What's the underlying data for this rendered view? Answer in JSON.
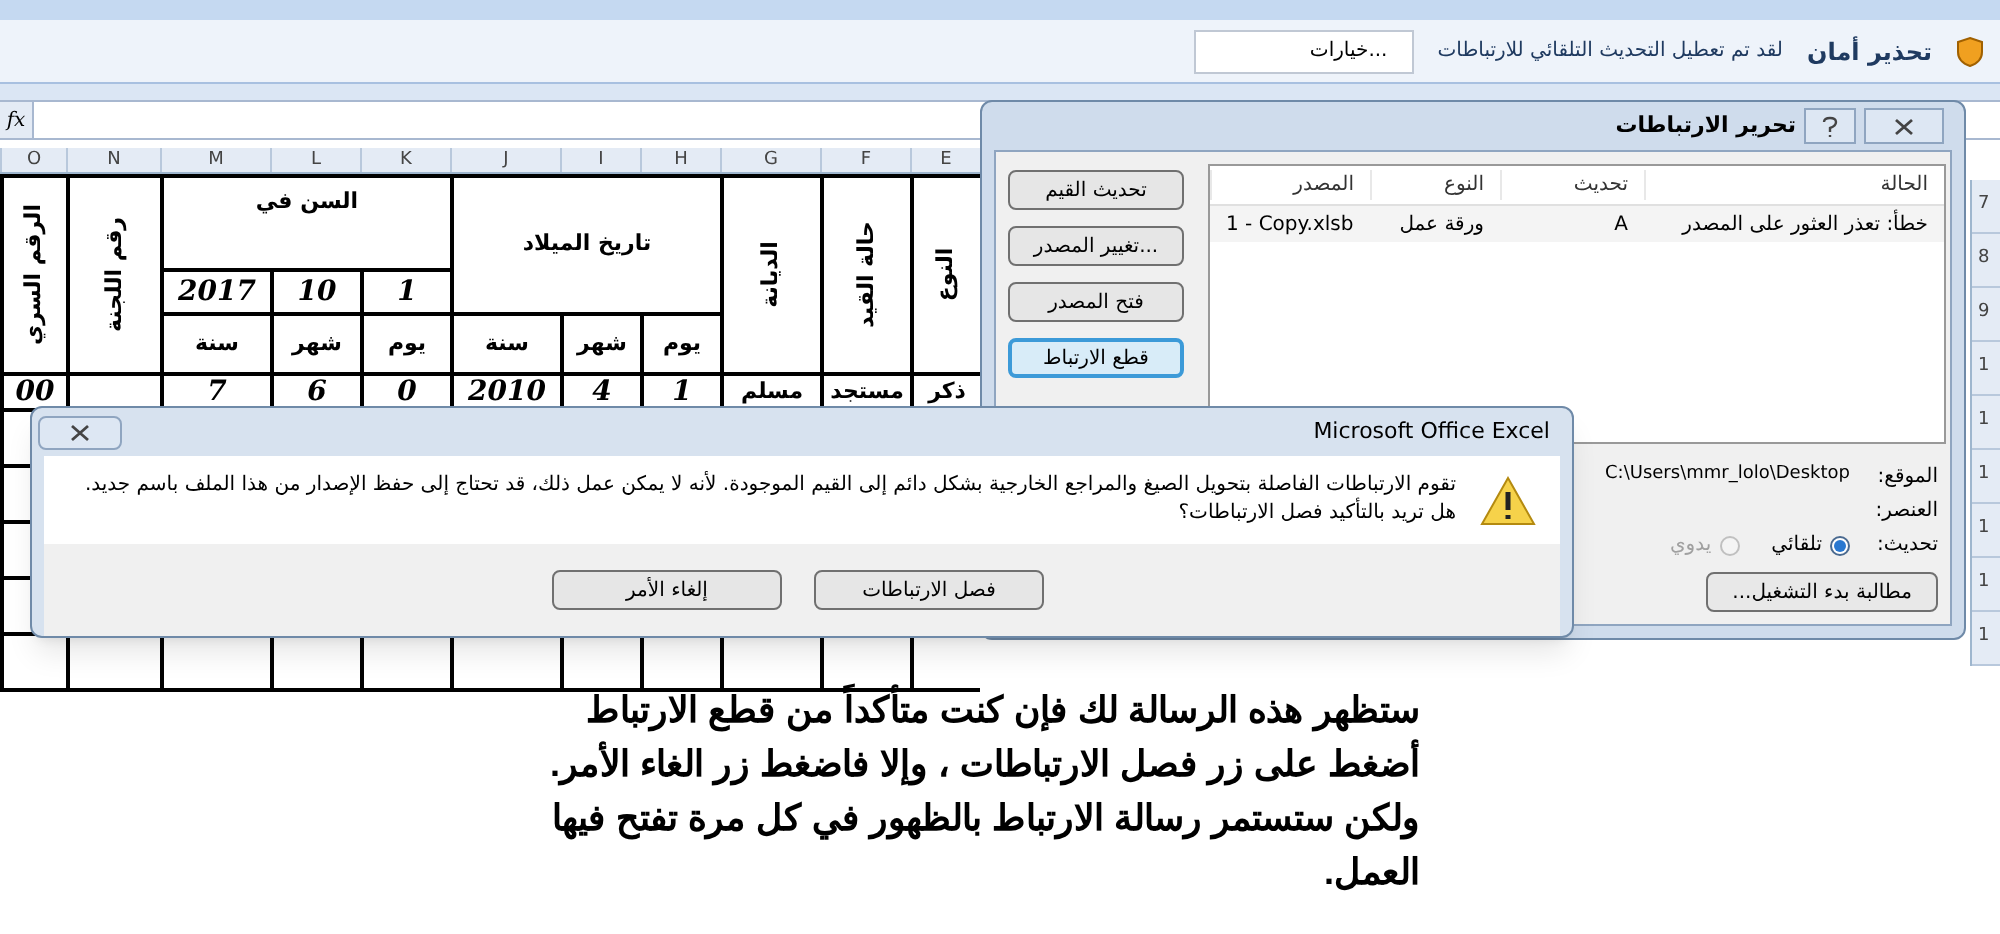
{
  "security_bar": {
    "title": "تحذير أمان",
    "message": "لقد تم تعطيل التحديث التلقائي للارتباطات",
    "options_button": "خيارات..."
  },
  "formula_bar": {
    "fx": "fx"
  },
  "columns": [
    "E",
    "F",
    "G",
    "H",
    "I",
    "J",
    "K",
    "L",
    "M",
    "N",
    "O"
  ],
  "sheet_header": {
    "gender": "النوع",
    "status": "حالة القيد",
    "religion": "الديانة",
    "birth_date": "تاريخ الميلاد",
    "birth_units": [
      "يوم",
      "شهر",
      "سنة"
    ],
    "age_at": "السن في",
    "age_date": [
      "1",
      "10",
      "2017"
    ],
    "age_units": [
      "يوم",
      "شهر",
      "سنة"
    ],
    "committee": "رقم اللجنة",
    "serial": "الرقم السري"
  },
  "data_row": [
    {
      "kind": "text",
      "text": "ذكر"
    },
    {
      "kind": "text",
      "text": "مستجد"
    },
    {
      "kind": "text",
      "text": "مسلم"
    },
    {
      "kind": "number",
      "text": "1"
    },
    {
      "kind": "number",
      "text": "4"
    },
    {
      "kind": "number",
      "text": "2010"
    },
    {
      "kind": "number",
      "text": "0"
    },
    {
      "kind": "number",
      "text": "6"
    },
    {
      "kind": "number",
      "text": "7"
    },
    {
      "kind": "empty"
    },
    {
      "kind": "number",
      "text": "00"
    }
  ],
  "row_numbers": [
    "7",
    "8",
    "9",
    "1",
    "1",
    "1",
    "1",
    "1",
    "1"
  ],
  "edit_links_dialog": {
    "title": "تحرير الارتباطات",
    "buttons": [
      {
        "label": "تحديث القيم",
        "focused": false
      },
      {
        "label": "تغيير المصدر...",
        "focused": false
      },
      {
        "label": "فتح المصدر",
        "focused": false
      },
      {
        "label": "قطع الارتباط",
        "focused": true
      }
    ],
    "table": {
      "columns": [
        "الحالة",
        "تحديث",
        "النوع",
        "المصدر"
      ],
      "rows": [
        [
          "خطأ: تعذر العثور على المصدر",
          "A",
          "ورقة عمل",
          "1 - Copy.xlsb"
        ]
      ]
    },
    "location_label": "الموقع:",
    "location": "C:\\Users\\mmr_lolo\\Desktop",
    "item_label": "العنصر:",
    "update_label": "تحديث:",
    "update_options": [
      {
        "label": "تلقائي",
        "selected": true,
        "disabled": false
      },
      {
        "label": "يدوي",
        "selected": false,
        "disabled": true
      }
    ],
    "startup_button": "مطالبة بدء التشغيل..."
  },
  "message_box": {
    "title": "Microsoft Office Excel",
    "message": "تقوم الارتباطات الفاصلة بتحويل الصيغ والمراجع الخارجية بشكل دائم إلى القيم الموجودة. لأنه لا يمكن عمل ذلك، قد تحتاج إلى حفظ الإصدار من هذا الملف باسم جديد. هل تريد بالتأكيد فصل الارتباطات؟",
    "buttons": [
      "فصل الارتباطات",
      "إلغاء الأمر"
    ]
  },
  "caption": [
    "ستظهر هذه الرسالة لك فإن كنت متأكداً من قطع الارتباط",
    "أضغط على زر فصل الارتباطات ، وإلا فاضغط زر الغاء الأمر.",
    "ولكن ستستمر رسالة الارتباط بالظهور في كل مرة تفتح فيها",
    "العمل."
  ]
}
